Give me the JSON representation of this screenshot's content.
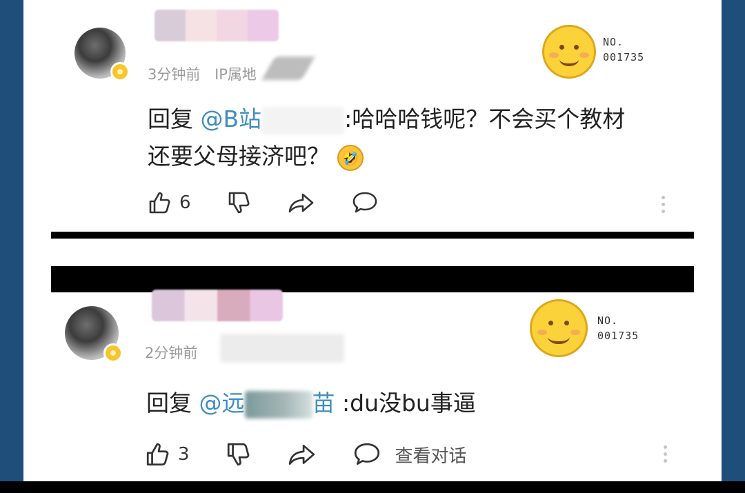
{
  "comments": [
    {
      "time": "3分钟前",
      "ip_label": "IP属地",
      "no_label": "NO.",
      "no_number": "001735",
      "reply_word": "回复",
      "mention": "@B站",
      "text_line1": ":哈哈哈钱呢？不会买个教材",
      "text_line2": "还要父母接济吧？",
      "emoji": "🤣",
      "likes": "6"
    },
    {
      "time": "2分钟前",
      "no_label": "NO.",
      "no_number": "001735",
      "reply_word": "回复",
      "mention": "@远",
      "mention_tail": "苗",
      "text": ":du没bu事逼",
      "likes": "3",
      "view_conversation": "查看对话"
    }
  ],
  "icons": [
    "thumbs-up-icon",
    "thumbs-down-icon",
    "share-icon",
    "comment-icon",
    "more-icon"
  ],
  "colors": {
    "mention": "#3f8cc1",
    "frame_border": "#1f4e7a",
    "badge": "#f6c62b"
  }
}
